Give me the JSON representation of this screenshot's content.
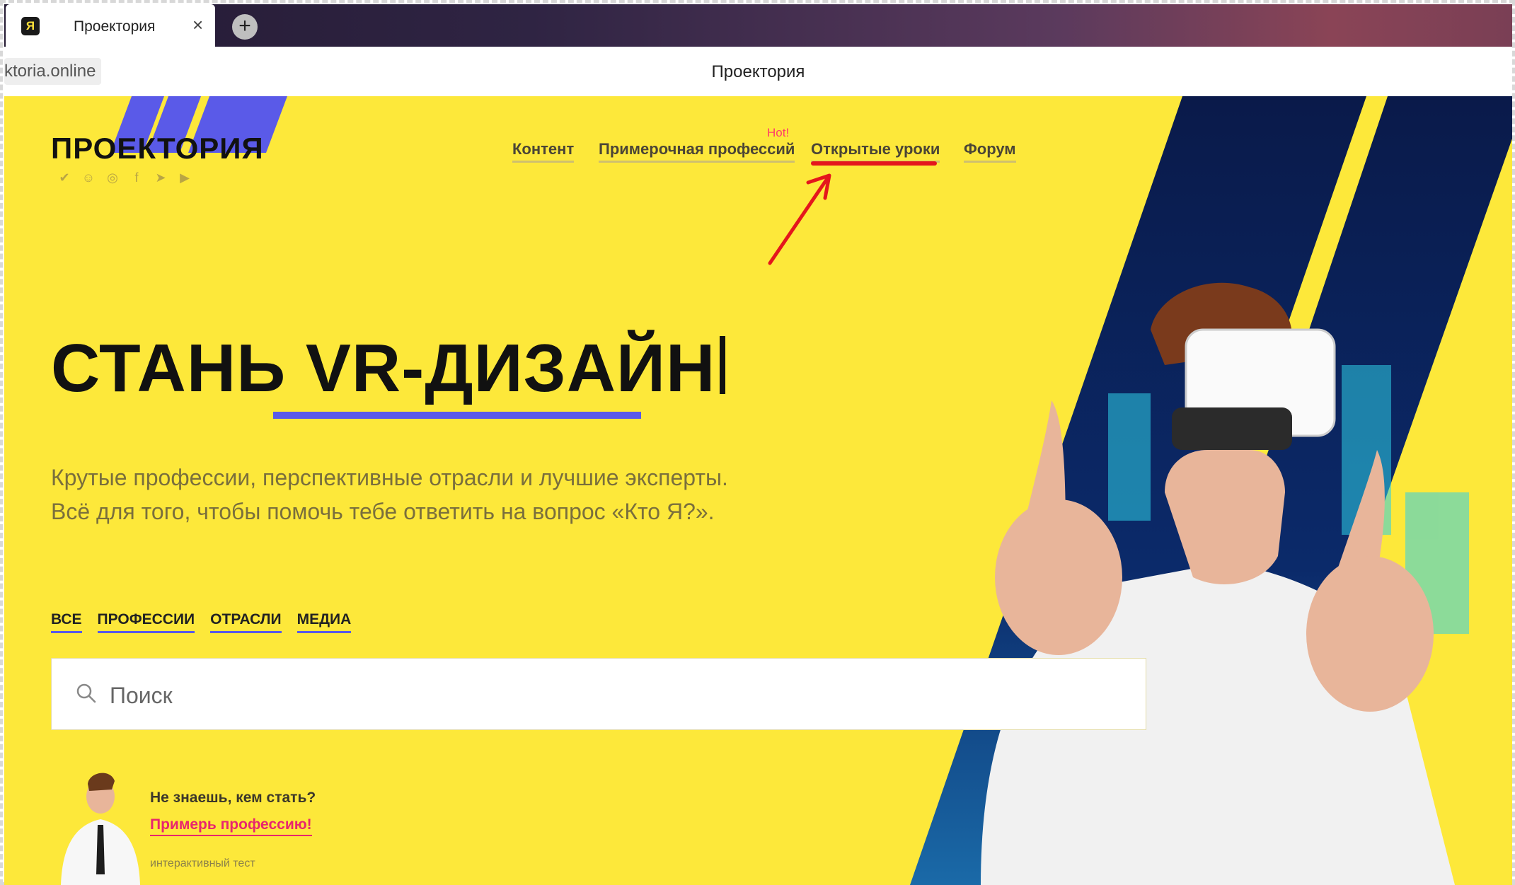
{
  "browser": {
    "tab_title": "Проектория",
    "tab_favicon": "Я",
    "url": "ktoria.online",
    "page_title": "Проектория"
  },
  "site": {
    "logo": "ПРОЕКТОРИЯ",
    "social_icons": [
      "vk-icon",
      "odnoklassniki-icon",
      "instagram-icon",
      "facebook-icon",
      "telegram-icon",
      "youtube-icon"
    ],
    "nav": {
      "content": "Контент",
      "try_profession": "Примерочная профессий",
      "open_lessons": "Открытые уроки",
      "forum": "Форум",
      "hot_badge": "Hot!"
    },
    "headline_prefix": "СТАНЬ ",
    "headline_word": "VR-ДИЗАЙН",
    "lead_line1": "Крутые профессии, перспективные отрасли и лучшие эксперты.",
    "lead_line2": "Всё для того, чтобы помочь тебе ответить на вопрос «Кто Я?».",
    "filters": [
      "ВСЕ",
      "ПРОФЕССИИ",
      "ОТРАСЛИ",
      "МЕДИА"
    ],
    "search_placeholder": "Поиск",
    "promo": {
      "question": "Не знаешь, кем стать?",
      "link": "Примерь профессию!",
      "subtitle": "интерактивный тест"
    }
  },
  "colors": {
    "brand_yellow": "#fde83a",
    "accent_blue": "#5a5ae8",
    "hot_pink": "#ff3b6a",
    "annotation_red": "#e4161c"
  }
}
